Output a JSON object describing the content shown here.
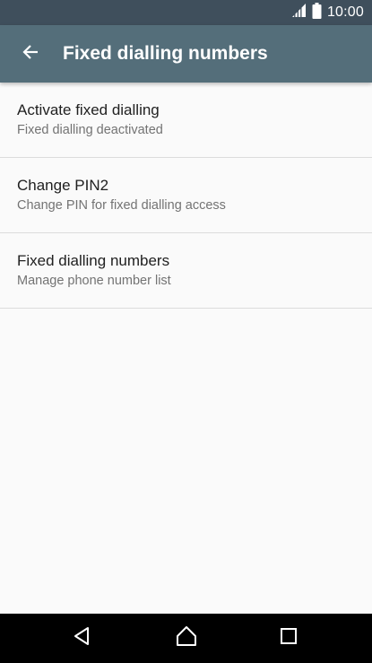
{
  "status_bar": {
    "time": "10:00",
    "icons": [
      "signal-icon",
      "battery-icon"
    ]
  },
  "app_bar": {
    "title": "Fixed dialling numbers",
    "back_icon": "arrow-back-icon",
    "color": "#546e7a"
  },
  "settings": [
    {
      "title": "Activate fixed dialling",
      "summary": "Fixed dialling deactivated"
    },
    {
      "title": "Change PIN2",
      "summary": "Change PIN for fixed dialling access"
    },
    {
      "title": "Fixed dialling numbers",
      "summary": "Manage phone number list"
    }
  ],
  "nav_bar": {
    "buttons": [
      "back-triangle-icon",
      "home-icon",
      "recents-square-icon"
    ]
  }
}
